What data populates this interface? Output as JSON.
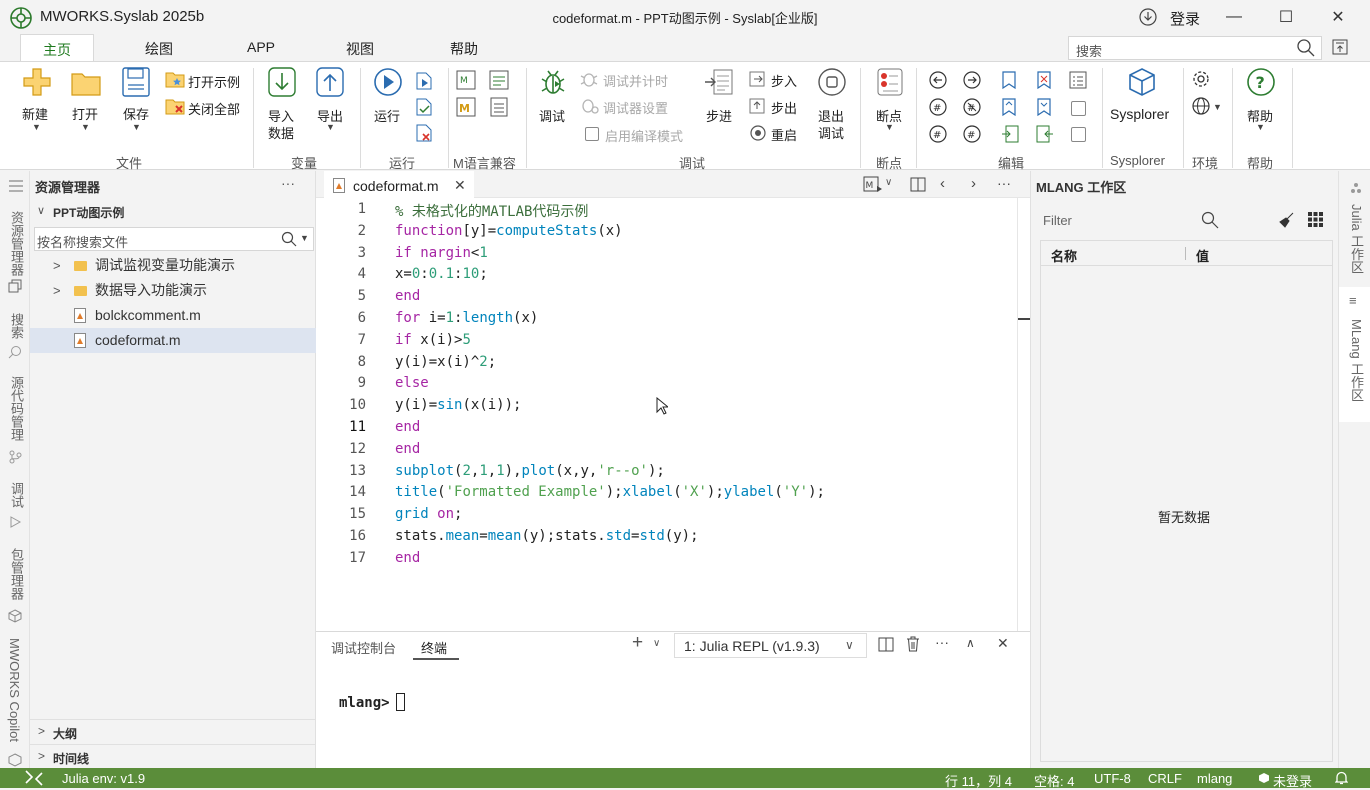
{
  "window": {
    "app_name": "MWORKS.Syslab 2025b",
    "title": "codeformat.m - PPT动图示例 - Syslab[企业版]",
    "login": "登录"
  },
  "menu": {
    "tabs": [
      "主页",
      "绘图",
      "APP",
      "视图",
      "帮助"
    ],
    "active_tab": "主页",
    "search_placeholder": "搜索"
  },
  "ribbon": {
    "file": {
      "new": "新建",
      "open": "打开",
      "save": "保存",
      "open_example": "打开示例",
      "close_all": "关闭全部",
      "group": "文件"
    },
    "variable": {
      "import": "导入",
      "import2": "数据",
      "export": "导出",
      "group": "变量"
    },
    "run": {
      "run": "运行",
      "group": "运行"
    },
    "mcompat": {
      "group": "M语言兼容"
    },
    "debug": {
      "debug": "调试",
      "debug_parallel": "调试并计时",
      "debugger_settings": "调试器设置",
      "enable_compile": "启用编译模式",
      "step": "步进",
      "step_in": "步入",
      "step_out": "步出",
      "restart": "重启",
      "exit1": "退出",
      "exit2": "调试",
      "group": "调试"
    },
    "breakpoint": {
      "label": "断点",
      "group": "断点"
    },
    "edit": {
      "group": "编辑"
    },
    "sysplorer": {
      "label": "Sysplorer",
      "group": "Sysplorer"
    },
    "environment": {
      "group": "环境"
    },
    "help": {
      "label": "帮助",
      "group": "帮助"
    }
  },
  "activity_bar": {
    "items": [
      "资源管理器",
      "搜索",
      "源代码管理",
      "调试",
      "包管理器",
      "MWORKS Copilot"
    ]
  },
  "explorer": {
    "title": "资源管理器",
    "more": "···",
    "project": "PPT动图示例",
    "search_placeholder": "按名称搜索文件",
    "items": [
      {
        "label": "调试监视变量功能演示",
        "type": "folder"
      },
      {
        "label": "数据导入功能演示",
        "type": "folder"
      },
      {
        "label": "bolckcomment.m",
        "type": "file"
      },
      {
        "label": "codeformat.m",
        "type": "file"
      }
    ],
    "outline": "大纲",
    "timeline": "时间线"
  },
  "editor": {
    "tab": "codeformat.m",
    "lines": [
      "% 未格式化的MATLAB代码示例",
      "function[y]=computeStats(x)",
      "if nargin<1",
      "x=0:0.1:10;",
      "end",
      "for i=1:length(x)",
      "if x(i)>5",
      "y(i)=x(i)^2;",
      "else",
      "y(i)=sin(x(i));",
      "end",
      "end",
      "subplot(2,1,1),plot(x,y,'r--o');",
      "title('Formatted Example');xlabel('X');ylabel('Y');",
      "grid on;",
      "stats.mean=mean(y);stats.std=std(y);",
      "end"
    ],
    "line_numbers": [
      "1",
      "2",
      "3",
      "4",
      "5",
      "6",
      "7",
      "8",
      "9",
      "10",
      "11",
      "12",
      "13",
      "14",
      "15",
      "16",
      "17"
    ]
  },
  "panel": {
    "tabs": [
      "调试控制台",
      "终端"
    ],
    "active_tab": "终端",
    "terminal_select": "1: Julia REPL (v1.9.3)",
    "prompt": "mlang>"
  },
  "workspace": {
    "title": "MLANG 工作区",
    "filter_placeholder": "Filter",
    "col_name": "名称",
    "col_value": "值",
    "empty": "暂无数据"
  },
  "right_bar": {
    "items": [
      "Julia 工作区",
      "MLang 工作区"
    ]
  },
  "status": {
    "env": "Julia env: v1.9",
    "position": "行 11，列 4",
    "spaces": "空格: 4",
    "encoding": "UTF-8",
    "eol": "CRLF",
    "language": "mlang",
    "user": "未登录"
  },
  "colors": {
    "accent_green": "#1f7a1f",
    "status_bar": "#5b8d3a",
    "keyword": "#a626a4",
    "function": "#0184bc",
    "string": "#50a14f",
    "number": "#2d9d78",
    "comment": "#3b6e3b"
  }
}
